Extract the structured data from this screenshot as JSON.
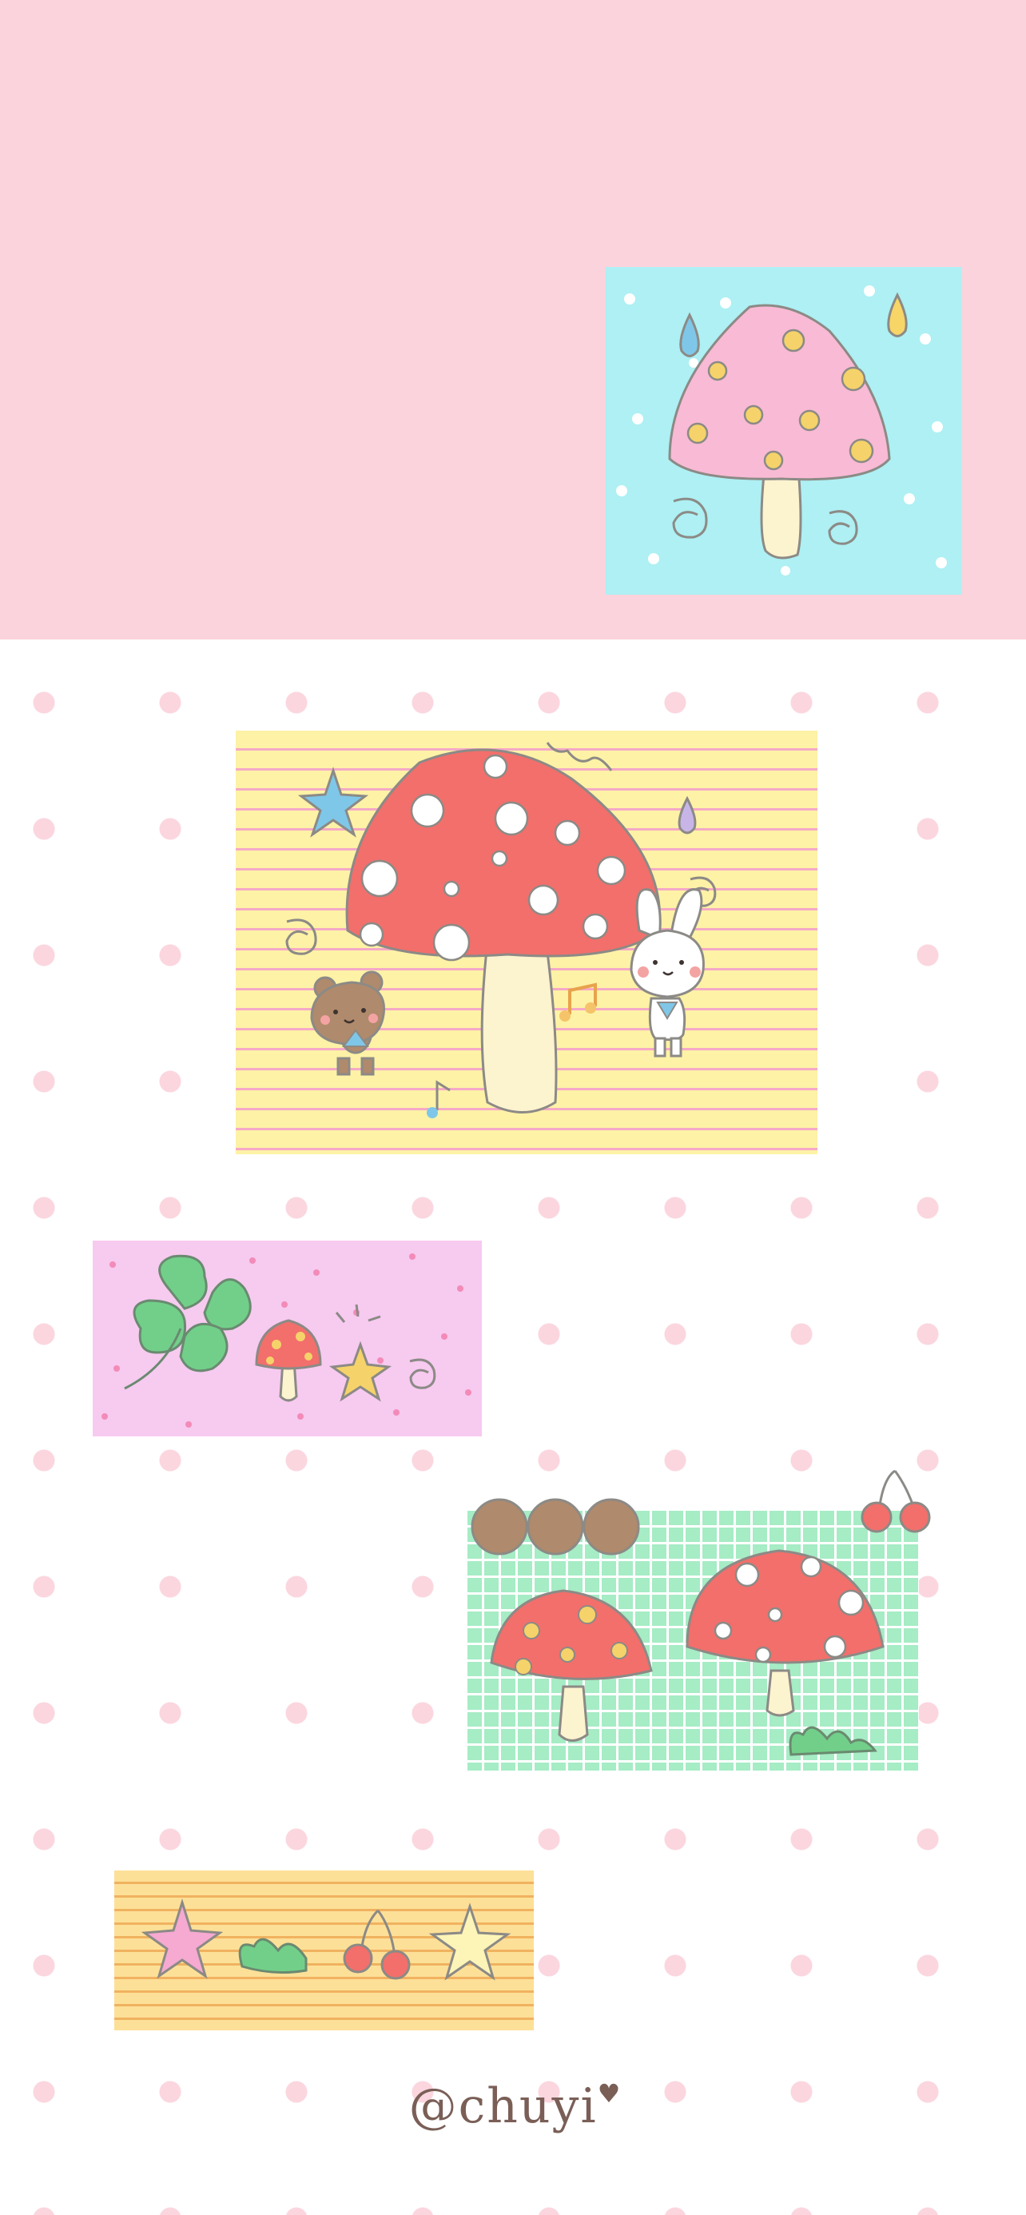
{
  "wallpaper": {
    "signature": "@chuyi",
    "signature_heart": "♥",
    "colors": {
      "top_band": "#fbd3dc",
      "dot": "#fbd6df",
      "mushroom_red": "#f26f6b",
      "mushroom_pink": "#f8bad4",
      "spot_yellow": "#f5d36a",
      "stem": "#fcf3cf",
      "outline": "#8c8a86"
    },
    "cards": [
      {
        "name": "cyan-mushroom-card",
        "icons": [
          "pink-mushroom-icon",
          "raindrop-icon",
          "swirl-icon"
        ]
      },
      {
        "name": "yellow-striped-card",
        "icons": [
          "red-mushroom-icon",
          "star-icon",
          "bear-icon",
          "bunny-icon",
          "music-note-icon"
        ]
      },
      {
        "name": "pink-clover-card",
        "icons": [
          "clover-icon",
          "small-mushroom-icon",
          "star-icon",
          "swirl-icon"
        ]
      },
      {
        "name": "green-grid-card",
        "icons": [
          "red-mushroom-icon",
          "chestnut-icon",
          "cherry-icon",
          "grass-icon"
        ]
      },
      {
        "name": "orange-striped-card",
        "icons": [
          "star-icon",
          "grass-icon",
          "cherry-icon"
        ]
      }
    ]
  }
}
